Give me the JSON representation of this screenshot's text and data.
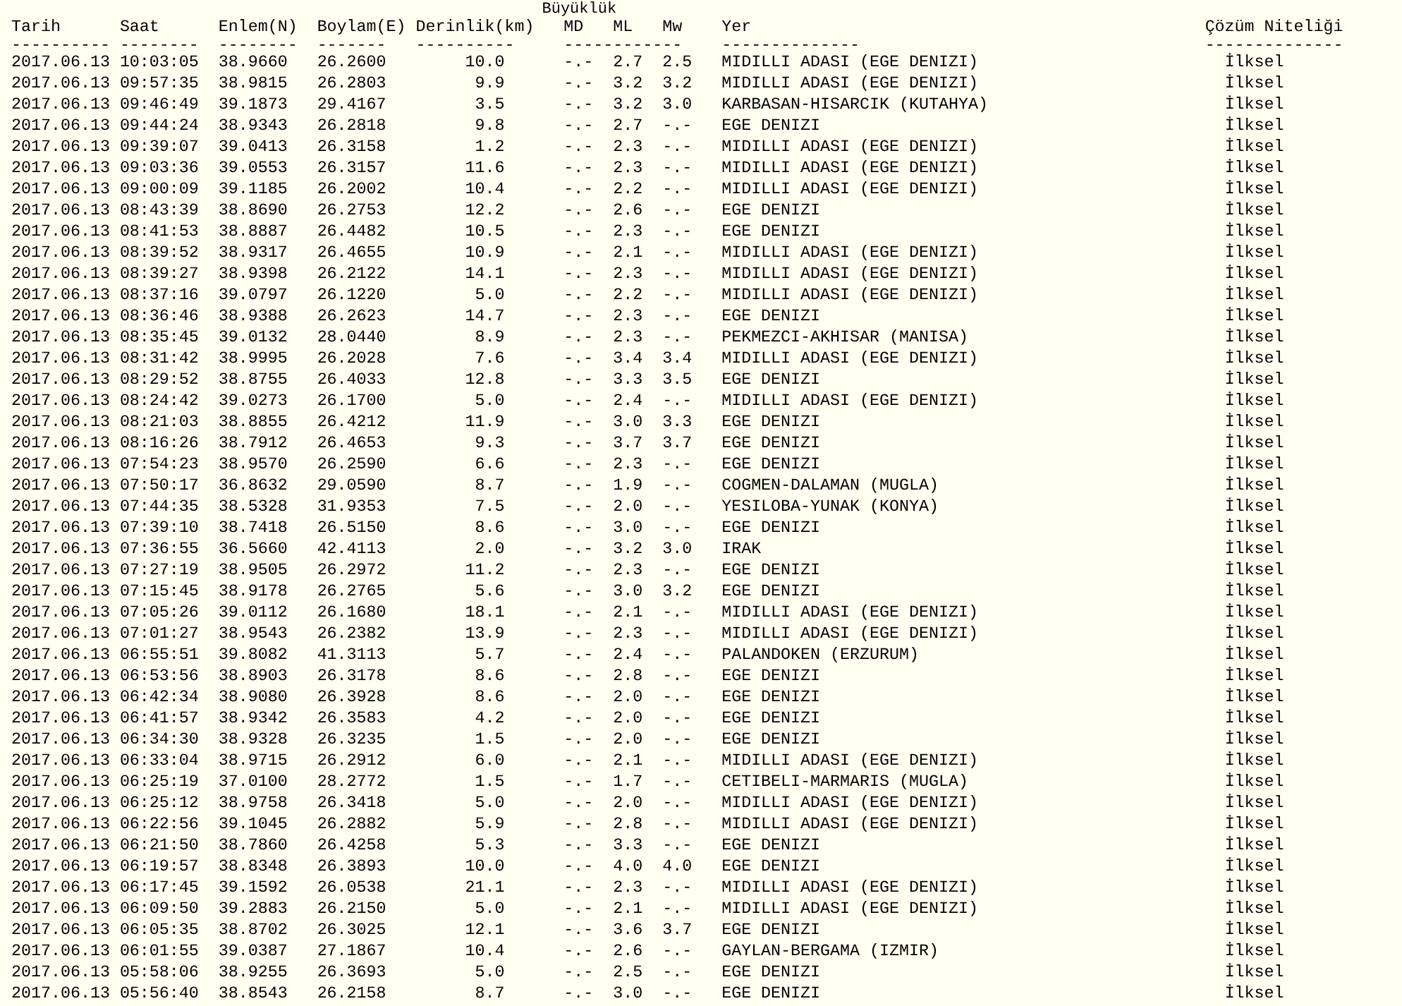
{
  "column_group": "Büyüklük",
  "columns": [
    "Tarih",
    "Saat",
    "Enlem(N)",
    "Boylam(E)",
    "Derinlik(km)",
    "MD",
    "ML",
    "Mw",
    "Yer",
    "Çözüm Niteliği"
  ],
  "separators": [
    "----------",
    "--------",
    "--------",
    "-------",
    "----------",
    "------------",
    "--------------",
    "--------------"
  ],
  "rows": [
    [
      "2017.06.13",
      "10:03:05",
      "38.9660",
      "26.2600",
      "10.0",
      "-.-",
      "2.7",
      "2.5",
      "MIDILLI ADASI (EGE DENIZI)",
      "İlksel"
    ],
    [
      "2017.06.13",
      "09:57:35",
      "38.9815",
      "26.2803",
      "9.9",
      "-.-",
      "3.2",
      "3.2",
      "MIDILLI ADASI (EGE DENIZI)",
      "İlksel"
    ],
    [
      "2017.06.13",
      "09:46:49",
      "39.1873",
      "29.4167",
      "3.5",
      "-.-",
      "3.2",
      "3.0",
      "KARBASAN-HISARCIK (KUTAHYA)",
      "İlksel"
    ],
    [
      "2017.06.13",
      "09:44:24",
      "38.9343",
      "26.2818",
      "9.8",
      "-.-",
      "2.7",
      "-.-",
      "EGE DENIZI",
      "İlksel"
    ],
    [
      "2017.06.13",
      "09:39:07",
      "39.0413",
      "26.3158",
      "1.2",
      "-.-",
      "2.3",
      "-.-",
      "MIDILLI ADASI (EGE DENIZI)",
      "İlksel"
    ],
    [
      "2017.06.13",
      "09:03:36",
      "39.0553",
      "26.3157",
      "11.6",
      "-.-",
      "2.3",
      "-.-",
      "MIDILLI ADASI (EGE DENIZI)",
      "İlksel"
    ],
    [
      "2017.06.13",
      "09:00:09",
      "39.1185",
      "26.2002",
      "10.4",
      "-.-",
      "2.2",
      "-.-",
      "MIDILLI ADASI (EGE DENIZI)",
      "İlksel"
    ],
    [
      "2017.06.13",
      "08:43:39",
      "38.8690",
      "26.2753",
      "12.2",
      "-.-",
      "2.6",
      "-.-",
      "EGE DENIZI",
      "İlksel"
    ],
    [
      "2017.06.13",
      "08:41:53",
      "38.8887",
      "26.4482",
      "10.5",
      "-.-",
      "2.3",
      "-.-",
      "EGE DENIZI",
      "İlksel"
    ],
    [
      "2017.06.13",
      "08:39:52",
      "38.9317",
      "26.4655",
      "10.9",
      "-.-",
      "2.1",
      "-.-",
      "MIDILLI ADASI (EGE DENIZI)",
      "İlksel"
    ],
    [
      "2017.06.13",
      "08:39:27",
      "38.9398",
      "26.2122",
      "14.1",
      "-.-",
      "2.3",
      "-.-",
      "MIDILLI ADASI (EGE DENIZI)",
      "İlksel"
    ],
    [
      "2017.06.13",
      "08:37:16",
      "39.0797",
      "26.1220",
      "5.0",
      "-.-",
      "2.2",
      "-.-",
      "MIDILLI ADASI (EGE DENIZI)",
      "İlksel"
    ],
    [
      "2017.06.13",
      "08:36:46",
      "38.9388",
      "26.2623",
      "14.7",
      "-.-",
      "2.3",
      "-.-",
      "EGE DENIZI",
      "İlksel"
    ],
    [
      "2017.06.13",
      "08:35:45",
      "39.0132",
      "28.0440",
      "8.9",
      "-.-",
      "2.3",
      "-.-",
      "PEKMEZCI-AKHISAR (MANISA)",
      "İlksel"
    ],
    [
      "2017.06.13",
      "08:31:42",
      "38.9995",
      "26.2028",
      "7.6",
      "-.-",
      "3.4",
      "3.4",
      "MIDILLI ADASI (EGE DENIZI)",
      "İlksel"
    ],
    [
      "2017.06.13",
      "08:29:52",
      "38.8755",
      "26.4033",
      "12.8",
      "-.-",
      "3.3",
      "3.5",
      "EGE DENIZI",
      "İlksel"
    ],
    [
      "2017.06.13",
      "08:24:42",
      "39.0273",
      "26.1700",
      "5.0",
      "-.-",
      "2.4",
      "-.-",
      "MIDILLI ADASI (EGE DENIZI)",
      "İlksel"
    ],
    [
      "2017.06.13",
      "08:21:03",
      "38.8855",
      "26.4212",
      "11.9",
      "-.-",
      "3.0",
      "3.3",
      "EGE DENIZI",
      "İlksel"
    ],
    [
      "2017.06.13",
      "08:16:26",
      "38.7912",
      "26.4653",
      "9.3",
      "-.-",
      "3.7",
      "3.7",
      "EGE DENIZI",
      "İlksel"
    ],
    [
      "2017.06.13",
      "07:54:23",
      "38.9570",
      "26.2590",
      "6.6",
      "-.-",
      "2.3",
      "-.-",
      "EGE DENIZI",
      "İlksel"
    ],
    [
      "2017.06.13",
      "07:50:17",
      "36.8632",
      "29.0590",
      "8.7",
      "-.-",
      "1.9",
      "-.-",
      "COGMEN-DALAMAN (MUGLA)",
      "İlksel"
    ],
    [
      "2017.06.13",
      "07:44:35",
      "38.5328",
      "31.9353",
      "7.5",
      "-.-",
      "2.0",
      "-.-",
      "YESILOBA-YUNAK (KONYA)",
      "İlksel"
    ],
    [
      "2017.06.13",
      "07:39:10",
      "38.7418",
      "26.5150",
      "8.6",
      "-.-",
      "3.0",
      "-.-",
      "EGE DENIZI",
      "İlksel"
    ],
    [
      "2017.06.13",
      "07:36:55",
      "36.5660",
      "42.4113",
      "2.0",
      "-.-",
      "3.2",
      "3.0",
      "IRAK",
      "İlksel"
    ],
    [
      "2017.06.13",
      "07:27:19",
      "38.9505",
      "26.2972",
      "11.2",
      "-.-",
      "2.3",
      "-.-",
      "EGE DENIZI",
      "İlksel"
    ],
    [
      "2017.06.13",
      "07:15:45",
      "38.9178",
      "26.2765",
      "5.6",
      "-.-",
      "3.0",
      "3.2",
      "EGE DENIZI",
      "İlksel"
    ],
    [
      "2017.06.13",
      "07:05:26",
      "39.0112",
      "26.1680",
      "18.1",
      "-.-",
      "2.1",
      "-.-",
      "MIDILLI ADASI (EGE DENIZI)",
      "İlksel"
    ],
    [
      "2017.06.13",
      "07:01:27",
      "38.9543",
      "26.2382",
      "13.9",
      "-.-",
      "2.3",
      "-.-",
      "MIDILLI ADASI (EGE DENIZI)",
      "İlksel"
    ],
    [
      "2017.06.13",
      "06:55:51",
      "39.8082",
      "41.3113",
      "5.7",
      "-.-",
      "2.4",
      "-.-",
      "PALANDOKEN (ERZURUM)",
      "İlksel"
    ],
    [
      "2017.06.13",
      "06:53:56",
      "38.8903",
      "26.3178",
      "8.6",
      "-.-",
      "2.8",
      "-.-",
      "EGE DENIZI",
      "İlksel"
    ],
    [
      "2017.06.13",
      "06:42:34",
      "38.9080",
      "26.3928",
      "8.6",
      "-.-",
      "2.0",
      "-.-",
      "EGE DENIZI",
      "İlksel"
    ],
    [
      "2017.06.13",
      "06:41:57",
      "38.9342",
      "26.3583",
      "4.2",
      "-.-",
      "2.0",
      "-.-",
      "EGE DENIZI",
      "İlksel"
    ],
    [
      "2017.06.13",
      "06:34:30",
      "38.9328",
      "26.3235",
      "1.5",
      "-.-",
      "2.0",
      "-.-",
      "EGE DENIZI",
      "İlksel"
    ],
    [
      "2017.06.13",
      "06:33:04",
      "38.9715",
      "26.2912",
      "6.0",
      "-.-",
      "2.1",
      "-.-",
      "MIDILLI ADASI (EGE DENIZI)",
      "İlksel"
    ],
    [
      "2017.06.13",
      "06:25:19",
      "37.0100",
      "28.2772",
      "1.5",
      "-.-",
      "1.7",
      "-.-",
      "CETIBELI-MARMARIS (MUGLA)",
      "İlksel"
    ],
    [
      "2017.06.13",
      "06:25:12",
      "38.9758",
      "26.3418",
      "5.0",
      "-.-",
      "2.0",
      "-.-",
      "MIDILLI ADASI (EGE DENIZI)",
      "İlksel"
    ],
    [
      "2017.06.13",
      "06:22:56",
      "39.1045",
      "26.2882",
      "5.9",
      "-.-",
      "2.8",
      "-.-",
      "MIDILLI ADASI (EGE DENIZI)",
      "İlksel"
    ],
    [
      "2017.06.13",
      "06:21:50",
      "38.7860",
      "26.4258",
      "5.3",
      "-.-",
      "3.3",
      "-.-",
      "EGE DENIZI",
      "İlksel"
    ],
    [
      "2017.06.13",
      "06:19:57",
      "38.8348",
      "26.3893",
      "10.0",
      "-.-",
      "4.0",
      "4.0",
      "EGE DENIZI",
      "İlksel"
    ],
    [
      "2017.06.13",
      "06:17:45",
      "39.1592",
      "26.0538",
      "21.1",
      "-.-",
      "2.3",
      "-.-",
      "MIDILLI ADASI (EGE DENIZI)",
      "İlksel"
    ],
    [
      "2017.06.13",
      "06:09:50",
      "39.2883",
      "26.2150",
      "5.0",
      "-.-",
      "2.1",
      "-.-",
      "MIDILLI ADASI (EGE DENIZI)",
      "İlksel"
    ],
    [
      "2017.06.13",
      "06:05:35",
      "38.8702",
      "26.3025",
      "12.1",
      "-.-",
      "3.6",
      "3.7",
      "EGE DENIZI",
      "İlksel"
    ],
    [
      "2017.06.13",
      "06:01:55",
      "39.0387",
      "27.1867",
      "10.4",
      "-.-",
      "2.6",
      "-.-",
      "GAYLAN-BERGAMA (IZMIR)",
      "İlksel"
    ],
    [
      "2017.06.13",
      "05:58:06",
      "38.9255",
      "26.3693",
      "5.0",
      "-.-",
      "2.5",
      "-.-",
      "EGE DENIZI",
      "İlksel"
    ],
    [
      "2017.06.13",
      "05:56:40",
      "38.8543",
      "26.2158",
      "8.7",
      "-.-",
      "3.0",
      "-.-",
      "EGE DENIZI",
      "İlksel"
    ]
  ]
}
